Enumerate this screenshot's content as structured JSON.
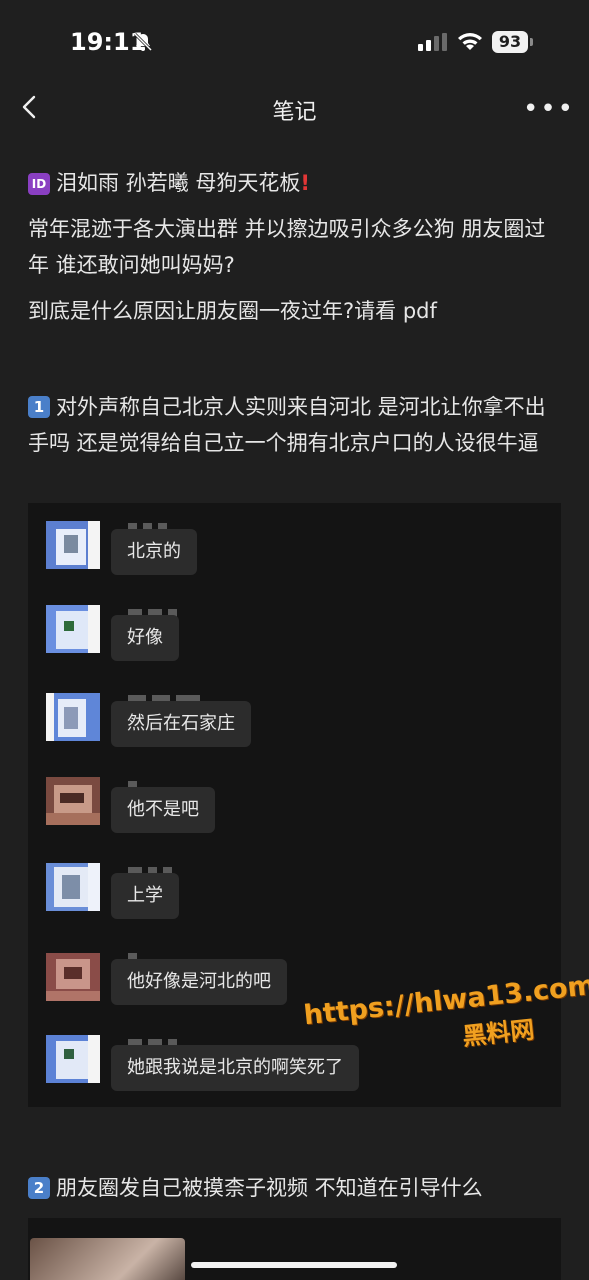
{
  "status": {
    "time": "19:11",
    "battery": "93"
  },
  "nav": {
    "title": "笔记",
    "more": "•••"
  },
  "post": {
    "line1_badge": "ID",
    "line1_text": "泪如雨 孙若曦 母狗天花板",
    "line1_mark": "!",
    "para1": "常年混迹于各大演出群 并以擦边吸引众多公狗 朋友圈过年 谁还敢问她叫妈妈?",
    "para2": "到底是什么原因让朋友圈一夜过年?请看 pdf",
    "item1_badge": "1",
    "item1_text": "对外声称自己北京人实则来自河北 是河北让你拿不出手吗 还是觉得给自己立一个拥有北京户口的人设很牛逼",
    "item2_badge": "2",
    "item2_text": "朋友圈发自己被摸柰子视频 不知道在引导什么"
  },
  "chat": {
    "messages": [
      {
        "text": "北京的",
        "avatar": "blue"
      },
      {
        "text": "好像",
        "avatar": "blue"
      },
      {
        "text": "然后在石家庄",
        "avatar": "blue"
      },
      {
        "text": "他不是吧",
        "avatar": "brown"
      },
      {
        "text": "上学",
        "avatar": "blue"
      },
      {
        "text": "他好像是河北的吧",
        "avatar": "brown"
      },
      {
        "text": "她跟我说是北京的啊笑死了",
        "avatar": "blue"
      }
    ]
  },
  "watermark": {
    "url": "https://hlwa13.com",
    "label": "黑料网"
  },
  "colors": {
    "background": "#1f1f1f",
    "chat_bg": "#141414",
    "bubble": "#2c2c2c",
    "watermark": "#f0a020",
    "id_badge": "#8a3fc2",
    "num_badge": "#4a7fc9"
  }
}
